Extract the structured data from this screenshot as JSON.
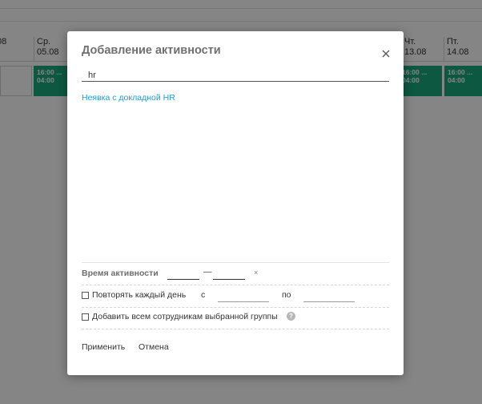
{
  "schedule": {
    "days": [
      {
        "weekday": "",
        "date": "08"
      },
      {
        "weekday": "Ср.",
        "date": "05.08"
      },
      {
        "weekday": "Чт.",
        "date": "13.08"
      },
      {
        "weekday": "Пт.",
        "date": "14.08"
      }
    ],
    "cells": [
      {
        "time_from": "16:00 ...",
        "time_to": "04:00"
      },
      {
        "time_from": "16:00 ...",
        "time_to": "04:00"
      },
      {
        "time_from": "16:00 ...",
        "time_to": "04:00"
      }
    ]
  },
  "dialog": {
    "title": "Добавление активности",
    "search_value": "hr",
    "result_item": "Неявка с докладной HR",
    "activity_time_label": "Время активности",
    "time_dash": "—",
    "clear_symbol": "×",
    "repeat_label": "Повторять каждый день",
    "from_label": "с",
    "to_label": "по",
    "add_all_label": "Добавить всем сотрудникам выбранной группы",
    "help_symbol": "?",
    "apply_label": "Применить",
    "cancel_label": "Отмена"
  }
}
